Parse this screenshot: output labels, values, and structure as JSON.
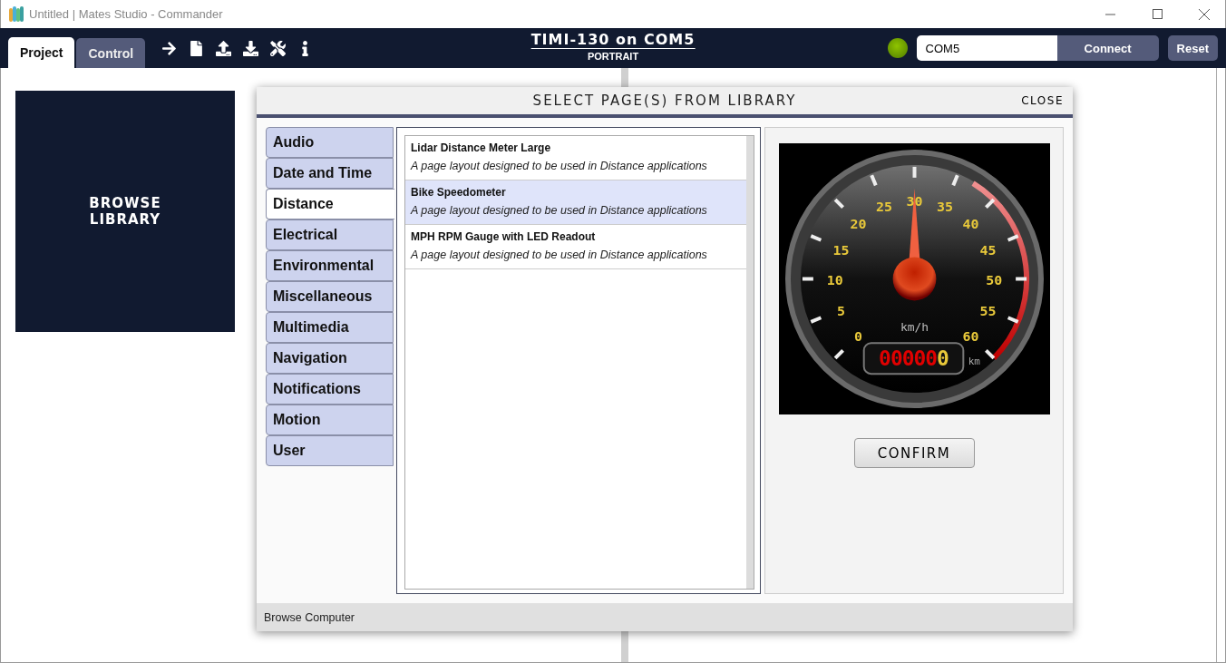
{
  "window": {
    "title": "Untitled | Mates Studio - Commander"
  },
  "toolbar": {
    "tabs": [
      {
        "label": "Project",
        "selected": true
      },
      {
        "label": "Control",
        "selected": false
      }
    ],
    "device": {
      "title": "TIMI-130 on COM5",
      "orientation": "PORTRAIT"
    },
    "connection": {
      "connected": true,
      "port": "COM5",
      "connect_label": "Connect",
      "reset_label": "Reset"
    }
  },
  "browse_tile": {
    "label": "BROWSE LIBRARY"
  },
  "dialog": {
    "title": "SELECT PAGE(S) FROM LIBRARY",
    "close": "CLOSE",
    "categories": [
      {
        "label": "Audio",
        "selected": false
      },
      {
        "label": "Date and Time",
        "selected": false
      },
      {
        "label": "Distance",
        "selected": true
      },
      {
        "label": "Electrical",
        "selected": false
      },
      {
        "label": "Environmental",
        "selected": false
      },
      {
        "label": "Miscellaneous",
        "selected": false
      },
      {
        "label": "Multimedia",
        "selected": false
      },
      {
        "label": "Navigation",
        "selected": false
      },
      {
        "label": "Notifications",
        "selected": false
      },
      {
        "label": "Motion",
        "selected": false
      },
      {
        "label": "User",
        "selected": false
      }
    ],
    "pages": [
      {
        "name": "Lidar Distance Meter Large",
        "description": "A page layout designed to be used in Distance applications",
        "selected": false
      },
      {
        "name": "Bike Speedometer",
        "description": "A page layout designed to be used in Distance applications",
        "selected": true
      },
      {
        "name": "MPH RPM Gauge with LED Readout",
        "description": "A page layout designed to be used in Distance applications",
        "selected": false
      }
    ],
    "preview": {
      "scale_labels": [
        "30",
        "25",
        "35",
        "20",
        "40",
        "15",
        "45",
        "10",
        "50",
        "5",
        "55",
        "0",
        "60"
      ],
      "unit": "km/h",
      "odometer": "000000",
      "odometer_unit": "km"
    },
    "confirm": "CONFIRM",
    "footer": "Browse Computer"
  }
}
